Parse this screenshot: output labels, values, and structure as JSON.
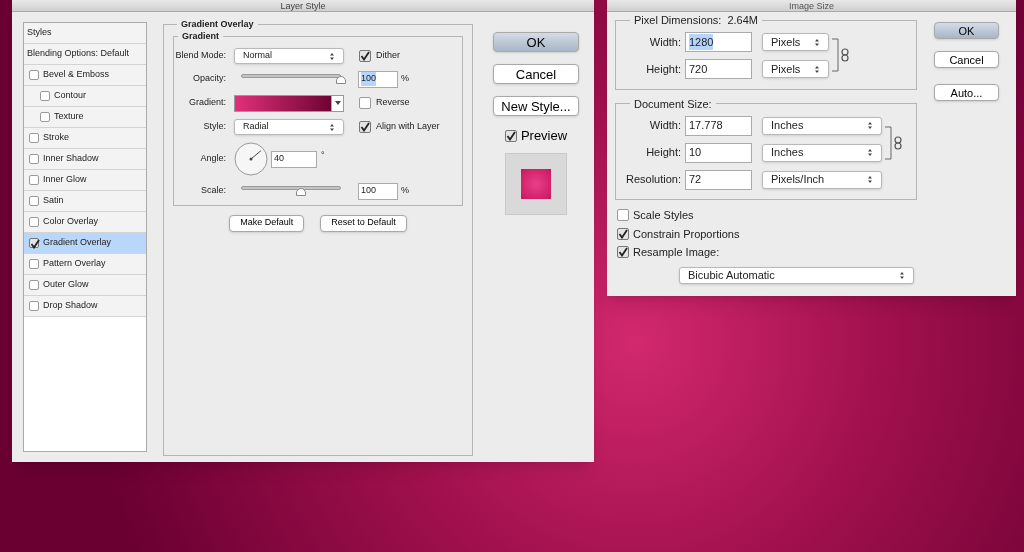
{
  "layer_style": {
    "title": "Layer Style",
    "styles": [
      {
        "label": "Styles",
        "kind": "header",
        "selected": false
      },
      {
        "label": "Blending Options: Default",
        "kind": "header",
        "selected": false
      },
      {
        "label": "Bevel & Emboss",
        "kind": "effect",
        "checked": false,
        "selected": false,
        "children": [
          {
            "label": "Contour",
            "kind": "effect",
            "checked": false,
            "selected": false
          },
          {
            "label": "Texture",
            "kind": "effect",
            "checked": false,
            "selected": false
          }
        ]
      },
      {
        "label": "Stroke",
        "kind": "effect",
        "checked": false,
        "selected": false
      },
      {
        "label": "Inner Shadow",
        "kind": "effect",
        "checked": false,
        "selected": false
      },
      {
        "label": "Inner Glow",
        "kind": "effect",
        "checked": false,
        "selected": false
      },
      {
        "label": "Satin",
        "kind": "effect",
        "checked": false,
        "selected": false
      },
      {
        "label": "Color Overlay",
        "kind": "effect",
        "checked": false,
        "selected": false
      },
      {
        "label": "Gradient Overlay",
        "kind": "effect",
        "checked": true,
        "selected": true
      },
      {
        "label": "Pattern Overlay",
        "kind": "effect",
        "checked": false,
        "selected": false
      },
      {
        "label": "Outer Glow",
        "kind": "effect",
        "checked": false,
        "selected": false
      },
      {
        "label": "Drop Shadow",
        "kind": "effect",
        "checked": false,
        "selected": false
      }
    ],
    "section_title": "Gradient Overlay",
    "group_title": "Gradient",
    "blend_mode": {
      "label": "Blend Mode:",
      "value": "Normal"
    },
    "dither": {
      "label": "Dither",
      "checked": true
    },
    "opacity": {
      "label": "Opacity:",
      "level": 1,
      "value": "100",
      "unit": "%",
      "highlighted": true
    },
    "gradient": {
      "label": "Gradient:"
    },
    "reverse": {
      "label": "Reverse",
      "checked": false
    },
    "style": {
      "label": "Style:",
      "value": "Radial"
    },
    "align_with_layer": {
      "label": "Align with Layer",
      "checked": true
    },
    "angle": {
      "label": "Angle:",
      "value": "40",
      "unit": "°"
    },
    "scale": {
      "label": "Scale:",
      "level": 0.6,
      "value": "100",
      "unit": "%",
      "highlighted": false
    },
    "buttons": [
      "Make Default",
      "Reset to Default"
    ],
    "side_buttons": [
      {
        "label": "OK",
        "primary": true
      },
      {
        "label": "Cancel",
        "primary": false
      },
      {
        "label": "New Style...",
        "primary": false
      }
    ],
    "preview": {
      "label": "Preview",
      "checked": true
    }
  },
  "image_size": {
    "title": "Image Size",
    "pixel_dimensions": {
      "title": "Pixel Dimensions:",
      "total": "2.64M",
      "rows": [
        {
          "label": "Width:",
          "value": "1280",
          "unit": "Pixels",
          "highlighted": true
        },
        {
          "label": "Height:",
          "value": "720",
          "unit": "Pixels",
          "highlighted": false
        }
      ]
    },
    "document_size": {
      "title": "Document Size:",
      "rows": [
        {
          "label": "Width:",
          "value": "17.778",
          "unit": "Inches",
          "highlighted": false
        },
        {
          "label": "Height:",
          "value": "10",
          "unit": "Inches",
          "highlighted": false
        },
        {
          "label": "Resolution:",
          "value": "72",
          "unit": "Pixels/Inch",
          "highlighted": false
        }
      ]
    },
    "options": [
      {
        "label": "Scale Styles",
        "checked": false
      },
      {
        "label": "Constrain Proportions",
        "checked": true
      },
      {
        "label": "Resample Image:",
        "checked": true
      }
    ],
    "resample_method": "Bicubic Automatic",
    "buttons": [
      {
        "label": "OK",
        "primary": true
      },
      {
        "label": "Cancel",
        "primary": false
      },
      {
        "label": "Auto...",
        "primary": false
      }
    ]
  }
}
